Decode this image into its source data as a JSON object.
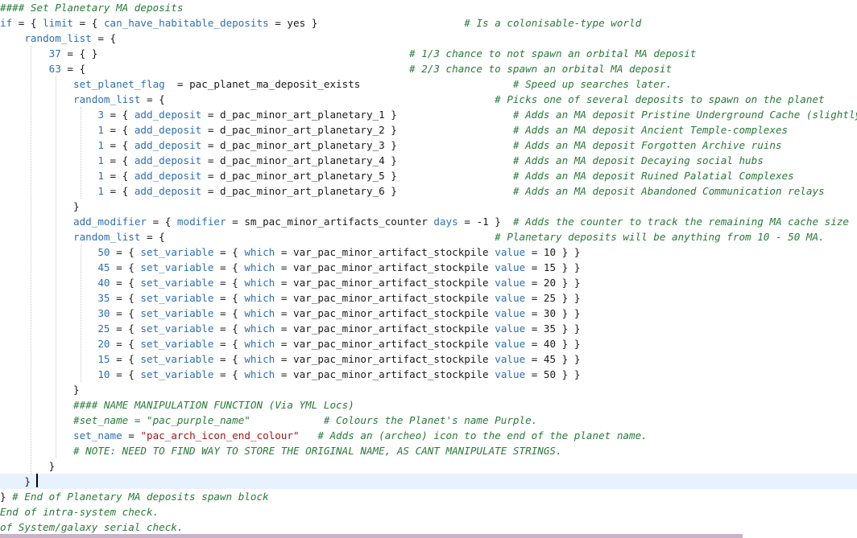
{
  "editor": {
    "colors": {
      "keyword": "#2f6fb1",
      "text": "#1a1a1a",
      "comment": "#2a7a3a",
      "string": "#a31515",
      "current_line": "#e8f2fe",
      "scrollbar": "#c9b3c9"
    },
    "lines": [
      [
        {
          "t": "c",
          "v": "#### Set Planetary MA deposits"
        }
      ],
      [
        {
          "t": "k",
          "v": "if"
        },
        {
          "t": "t",
          "v": " = { "
        },
        {
          "t": "k",
          "v": "limit"
        },
        {
          "t": "t",
          "v": " = { "
        },
        {
          "t": "k",
          "v": "can_have_habitable_deposits"
        },
        {
          "t": "t",
          "v": " = yes }                        "
        },
        {
          "t": "c",
          "v": "# Is a colonisable-type world"
        }
      ],
      [
        {
          "t": "t",
          "v": "    "
        },
        {
          "t": "k",
          "v": "random_list"
        },
        {
          "t": "t",
          "v": " = {"
        }
      ],
      [
        {
          "t": "t",
          "v": "        "
        },
        {
          "t": "n",
          "v": "37"
        },
        {
          "t": "t",
          "v": " = { }                                                   "
        },
        {
          "t": "c",
          "v": "# 1/3 chance to not spawn an orbital MA deposit"
        }
      ],
      [
        {
          "t": "t",
          "v": "        "
        },
        {
          "t": "n",
          "v": "63"
        },
        {
          "t": "t",
          "v": " = {                                                     "
        },
        {
          "t": "c",
          "v": "# 2/3 chance to spawn an orbital MA deposit"
        }
      ],
      [
        {
          "t": "t",
          "v": "            "
        },
        {
          "t": "k",
          "v": "set_planet_flag"
        },
        {
          "t": "t",
          "v": "  = pac_planet_ma_deposit_exists                         "
        },
        {
          "t": "c",
          "v": "# Speed up searches later."
        }
      ],
      [
        {
          "t": "t",
          "v": "            "
        },
        {
          "t": "k",
          "v": "random_list"
        },
        {
          "t": "t",
          "v": " = {                                                      "
        },
        {
          "t": "c",
          "v": "# Picks one of several deposits to spawn on the planet"
        }
      ],
      [
        {
          "t": "t",
          "v": "                "
        },
        {
          "t": "n",
          "v": "3"
        },
        {
          "t": "t",
          "v": " = { "
        },
        {
          "t": "k",
          "v": "add_deposit"
        },
        {
          "t": "t",
          "v": " = d_pac_minor_art_planetary_1 }                   "
        },
        {
          "t": "c",
          "v": "# Adds an MA deposit Pristine Underground Cache (slightly"
        }
      ],
      [
        {
          "t": "t",
          "v": "                "
        },
        {
          "t": "n",
          "v": "1"
        },
        {
          "t": "t",
          "v": " = { "
        },
        {
          "t": "k",
          "v": "add_deposit"
        },
        {
          "t": "t",
          "v": " = d_pac_minor_art_planetary_2 }                   "
        },
        {
          "t": "c",
          "v": "# Adds an MA deposit Ancient Temple-complexes"
        }
      ],
      [
        {
          "t": "t",
          "v": "                "
        },
        {
          "t": "n",
          "v": "1"
        },
        {
          "t": "t",
          "v": " = { "
        },
        {
          "t": "k",
          "v": "add_deposit"
        },
        {
          "t": "t",
          "v": " = d_pac_minor_art_planetary_3 }                   "
        },
        {
          "t": "c",
          "v": "# Adds an MA deposit Forgotten Archive ruins"
        }
      ],
      [
        {
          "t": "t",
          "v": "                "
        },
        {
          "t": "n",
          "v": "1"
        },
        {
          "t": "t",
          "v": " = { "
        },
        {
          "t": "k",
          "v": "add_deposit"
        },
        {
          "t": "t",
          "v": " = d_pac_minor_art_planetary_4 }                   "
        },
        {
          "t": "c",
          "v": "# Adds an MA deposit Decaying social hubs"
        }
      ],
      [
        {
          "t": "t",
          "v": "                "
        },
        {
          "t": "n",
          "v": "1"
        },
        {
          "t": "t",
          "v": " = { "
        },
        {
          "t": "k",
          "v": "add_deposit"
        },
        {
          "t": "t",
          "v": " = d_pac_minor_art_planetary_5 }                   "
        },
        {
          "t": "c",
          "v": "# Adds an MA deposit Ruined Palatial Complexes"
        }
      ],
      [
        {
          "t": "t",
          "v": "                "
        },
        {
          "t": "n",
          "v": "1"
        },
        {
          "t": "t",
          "v": " = { "
        },
        {
          "t": "k",
          "v": "add_deposit"
        },
        {
          "t": "t",
          "v": " = d_pac_minor_art_planetary_6 }                   "
        },
        {
          "t": "c",
          "v": "# Adds an MA deposit Abandoned Communication relays"
        }
      ],
      [
        {
          "t": "t",
          "v": "            }"
        }
      ],
      [
        {
          "t": "t",
          "v": "            "
        },
        {
          "t": "k",
          "v": "add_modifier"
        },
        {
          "t": "t",
          "v": " = { "
        },
        {
          "t": "k",
          "v": "modifier"
        },
        {
          "t": "t",
          "v": " = sm_pac_minor_artifacts_counter "
        },
        {
          "t": "k",
          "v": "days"
        },
        {
          "t": "t",
          "v": " = -1 }  "
        },
        {
          "t": "c",
          "v": "# Adds the counter to track the remaining MA cache size"
        }
      ],
      [
        {
          "t": "t",
          "v": "            "
        },
        {
          "t": "k",
          "v": "random_list"
        },
        {
          "t": "t",
          "v": " = {                                                      "
        },
        {
          "t": "c",
          "v": "# Planetary deposits will be anything from 10 - 50 MA."
        }
      ],
      [
        {
          "t": "t",
          "v": "                "
        },
        {
          "t": "n",
          "v": "50"
        },
        {
          "t": "t",
          "v": " = { "
        },
        {
          "t": "k",
          "v": "set_variable"
        },
        {
          "t": "t",
          "v": " = { "
        },
        {
          "t": "k",
          "v": "which"
        },
        {
          "t": "t",
          "v": " = var_pac_minor_artifact_stockpile "
        },
        {
          "t": "k",
          "v": "value"
        },
        {
          "t": "t",
          "v": " = 10 } }"
        }
      ],
      [
        {
          "t": "t",
          "v": "                "
        },
        {
          "t": "n",
          "v": "45"
        },
        {
          "t": "t",
          "v": " = { "
        },
        {
          "t": "k",
          "v": "set_variable"
        },
        {
          "t": "t",
          "v": " = { "
        },
        {
          "t": "k",
          "v": "which"
        },
        {
          "t": "t",
          "v": " = var_pac_minor_artifact_stockpile "
        },
        {
          "t": "k",
          "v": "value"
        },
        {
          "t": "t",
          "v": " = 15 } }"
        }
      ],
      [
        {
          "t": "t",
          "v": "                "
        },
        {
          "t": "n",
          "v": "40"
        },
        {
          "t": "t",
          "v": " = { "
        },
        {
          "t": "k",
          "v": "set_variable"
        },
        {
          "t": "t",
          "v": " = { "
        },
        {
          "t": "k",
          "v": "which"
        },
        {
          "t": "t",
          "v": " = var_pac_minor_artifact_stockpile "
        },
        {
          "t": "k",
          "v": "value"
        },
        {
          "t": "t",
          "v": " = 20 } }"
        }
      ],
      [
        {
          "t": "t",
          "v": "                "
        },
        {
          "t": "n",
          "v": "35"
        },
        {
          "t": "t",
          "v": " = { "
        },
        {
          "t": "k",
          "v": "set_variable"
        },
        {
          "t": "t",
          "v": " = { "
        },
        {
          "t": "k",
          "v": "which"
        },
        {
          "t": "t",
          "v": " = var_pac_minor_artifact_stockpile "
        },
        {
          "t": "k",
          "v": "value"
        },
        {
          "t": "t",
          "v": " = 25 } }"
        }
      ],
      [
        {
          "t": "t",
          "v": "                "
        },
        {
          "t": "n",
          "v": "30"
        },
        {
          "t": "t",
          "v": " = { "
        },
        {
          "t": "k",
          "v": "set_variable"
        },
        {
          "t": "t",
          "v": " = { "
        },
        {
          "t": "k",
          "v": "which"
        },
        {
          "t": "t",
          "v": " = var_pac_minor_artifact_stockpile "
        },
        {
          "t": "k",
          "v": "value"
        },
        {
          "t": "t",
          "v": " = 30 } }"
        }
      ],
      [
        {
          "t": "t",
          "v": "                "
        },
        {
          "t": "n",
          "v": "25"
        },
        {
          "t": "t",
          "v": " = { "
        },
        {
          "t": "k",
          "v": "set_variable"
        },
        {
          "t": "t",
          "v": " = { "
        },
        {
          "t": "k",
          "v": "which"
        },
        {
          "t": "t",
          "v": " = var_pac_minor_artifact_stockpile "
        },
        {
          "t": "k",
          "v": "value"
        },
        {
          "t": "t",
          "v": " = 35 } }"
        }
      ],
      [
        {
          "t": "t",
          "v": "                "
        },
        {
          "t": "n",
          "v": "20"
        },
        {
          "t": "t",
          "v": " = { "
        },
        {
          "t": "k",
          "v": "set_variable"
        },
        {
          "t": "t",
          "v": " = { "
        },
        {
          "t": "k",
          "v": "which"
        },
        {
          "t": "t",
          "v": " = var_pac_minor_artifact_stockpile "
        },
        {
          "t": "k",
          "v": "value"
        },
        {
          "t": "t",
          "v": " = 40 } }"
        }
      ],
      [
        {
          "t": "t",
          "v": "                "
        },
        {
          "t": "n",
          "v": "15"
        },
        {
          "t": "t",
          "v": " = { "
        },
        {
          "t": "k",
          "v": "set_variable"
        },
        {
          "t": "t",
          "v": " = { "
        },
        {
          "t": "k",
          "v": "which"
        },
        {
          "t": "t",
          "v": " = var_pac_minor_artifact_stockpile "
        },
        {
          "t": "k",
          "v": "value"
        },
        {
          "t": "t",
          "v": " = 45 } }"
        }
      ],
      [
        {
          "t": "t",
          "v": "                "
        },
        {
          "t": "n",
          "v": "10"
        },
        {
          "t": "t",
          "v": " = { "
        },
        {
          "t": "k",
          "v": "set_variable"
        },
        {
          "t": "t",
          "v": " = { "
        },
        {
          "t": "k",
          "v": "which"
        },
        {
          "t": "t",
          "v": " = var_pac_minor_artifact_stockpile "
        },
        {
          "t": "k",
          "v": "value"
        },
        {
          "t": "t",
          "v": " = 50 } }"
        }
      ],
      [
        {
          "t": "t",
          "v": "            }"
        }
      ],
      [
        {
          "t": "t",
          "v": "            "
        },
        {
          "t": "c",
          "v": "#### NAME MANIPULATION FUNCTION (Via YML Locs)"
        }
      ],
      [
        {
          "t": "t",
          "v": "            "
        },
        {
          "t": "c",
          "v": "#set_name = \"pac_purple_name\"            # Colours the Planet's name Purple."
        }
      ],
      [
        {
          "t": "t",
          "v": "            "
        },
        {
          "t": "k",
          "v": "set_name"
        },
        {
          "t": "t",
          "v": " = "
        },
        {
          "t": "s",
          "v": "\"pac_arch_icon_end_colour\""
        },
        {
          "t": "t",
          "v": "   "
        },
        {
          "t": "c",
          "v": "# Adds an (archeo) icon to the end of the planet name."
        }
      ],
      [
        {
          "t": "t",
          "v": "            "
        },
        {
          "t": "c",
          "v": "# NOTE: NEED TO FIND WAY TO STORE THE ORIGINAL NAME, AS CANT MANIPULATE STRINGS."
        }
      ],
      [
        {
          "t": "t",
          "v": "        }"
        }
      ],
      [
        {
          "t": "t",
          "v": "    }"
        }
      ],
      [
        {
          "t": "t",
          "v": "} "
        },
        {
          "t": "c",
          "v": "# End of Planetary MA deposits spawn block"
        }
      ],
      [
        {
          "t": "c",
          "v": "End of intra-system check."
        }
      ],
      [
        {
          "t": "c",
          "v": "of System/galaxy serial check."
        }
      ]
    ]
  }
}
